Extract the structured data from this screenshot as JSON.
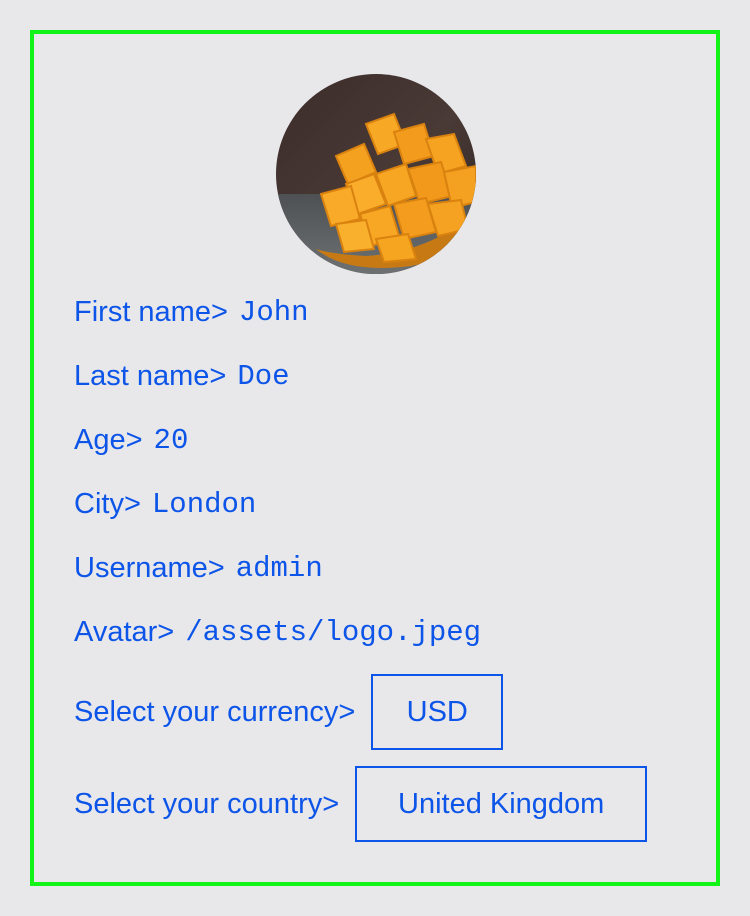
{
  "profile": {
    "avatar_alt": "mango",
    "fields": [
      {
        "label": "First name>",
        "value": "John"
      },
      {
        "label": "Last name>",
        "value": "Doe"
      },
      {
        "label": "Age>",
        "value": "20"
      },
      {
        "label": "City>",
        "value": "London"
      },
      {
        "label": "Username>",
        "value": "admin"
      },
      {
        "label": "Avatar>",
        "value": "/assets/logo.jpeg"
      }
    ],
    "currency": {
      "label": "Select your currency>",
      "value": "USD"
    },
    "country": {
      "label": "Select your country>",
      "value": "United Kingdom"
    }
  },
  "colors": {
    "background": "#e8e7ea",
    "border": "#12f317",
    "text": "#0c55e8"
  }
}
